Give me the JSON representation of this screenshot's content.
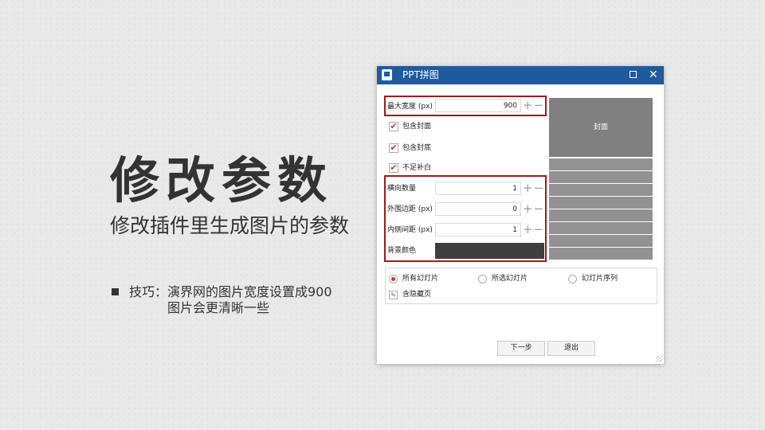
{
  "slide": {
    "title": "修改参数",
    "subtitle": "修改插件里生成图片的参数",
    "tip_line1": "技巧：演界网的图片宽度设置成900",
    "tip_line2": "图片会更清晰一些"
  },
  "dialog": {
    "title": "PPT拼图",
    "max_width": {
      "label": "最大宽度 (px)",
      "value": "900"
    },
    "stepper_symbol": "+−",
    "include_cover": {
      "label": "包含封面",
      "checked": true
    },
    "include_back": {
      "label": "包含封底",
      "checked": true
    },
    "fill_blank": {
      "label": "不足补白",
      "checked": true
    },
    "check_mark": "✔",
    "columns": {
      "label": "横向数量",
      "value": "1"
    },
    "outer_margin": {
      "label": "外围边距 (px)",
      "value": "0"
    },
    "inner_spacing": {
      "label": "内侧间距 (px)",
      "value": "1"
    },
    "bg_color": {
      "label": "背景颜色",
      "color": "#3f3f3f"
    },
    "preview": {
      "cover_label": "封面",
      "cover_color": "#808080",
      "tile_count": 8
    },
    "range": {
      "options": [
        "所有幻灯片",
        "所选幻灯片",
        "幻灯片序列"
      ],
      "selected": "所有幻灯片",
      "include_hidden": "含隐藏页"
    },
    "buttons": {
      "next": "下一步",
      "exit": "退出"
    },
    "highlight_color": "#9b1b1b"
  }
}
